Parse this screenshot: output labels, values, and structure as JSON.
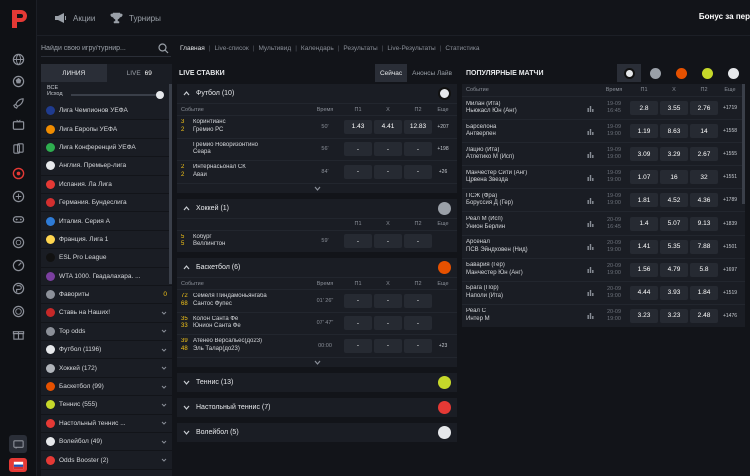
{
  "colors": {
    "brand": "#e53935",
    "accent_yellow": "#f5c518",
    "panel": "#1a1d24",
    "bg": "#121419"
  },
  "topbar": {
    "promos_label": "Акции",
    "tournaments_label": "Турниры",
    "bonus_label": "Бонус за пер"
  },
  "search": {
    "placeholder": "Найди свою игру/турнир..."
  },
  "breadcrumbs": [
    "Главная",
    "Live-список",
    "Мультивид",
    "Календарь",
    "Результаты",
    "Live-Результаты",
    "Статистика"
  ],
  "left": {
    "tab_line": "ЛИНИЯ",
    "tab_live": "LIVE",
    "tab_live_count": "69",
    "slider_label_1": "ВСЕ",
    "slider_label_2": "Исход",
    "items": [
      {
        "label": "Лига Чемпионов УЕФА",
        "icon": "ucl-icon",
        "color": "#1f3b8f",
        "badge": "",
        "chev": false
      },
      {
        "label": "Лига Европы УЕФА",
        "icon": "uel-icon",
        "color": "#f08c00",
        "badge": "",
        "chev": false
      },
      {
        "label": "Лига Конференций УЕФА",
        "icon": "uecl-icon",
        "color": "#2eae4f",
        "badge": "",
        "chev": false
      },
      {
        "label": "Англия. Премьер-лига",
        "icon": "epl-icon",
        "color": "#e6e8eb",
        "badge": "",
        "chev": false
      },
      {
        "label": "Испания. Ла Лига",
        "icon": "laliga-icon",
        "color": "#e53935",
        "badge": "",
        "chev": false
      },
      {
        "label": "Германия. Бундеслига",
        "icon": "bundesliga-icon",
        "color": "#d32f2f",
        "badge": "",
        "chev": false
      },
      {
        "label": "Италия. Серия А",
        "icon": "seriea-icon",
        "color": "#2e7bd6",
        "badge": "",
        "chev": false
      },
      {
        "label": "Франция. Лига 1",
        "icon": "ligue1-icon",
        "color": "#ffd54f",
        "badge": "",
        "chev": false
      },
      {
        "label": "ESL Pro League",
        "icon": "esl-icon",
        "color": "#111111",
        "badge": "",
        "chev": false
      },
      {
        "label": "WTA 1000. Гвадалахара. ...",
        "icon": "wta-icon",
        "color": "#7b3fa0",
        "badge": "",
        "chev": false
      },
      {
        "label": "Фавориты",
        "icon": "star-icon",
        "color": "#8c9099",
        "badge": "0",
        "chev": false
      },
      {
        "label": "Ставь на Наших!",
        "icon": "flag-icon",
        "color": "#c62828",
        "badge": "",
        "chev": true
      },
      {
        "label": "Top odds",
        "icon": "top-odds-icon",
        "color": "#8c9099",
        "badge": "",
        "chev": true
      },
      {
        "label": "Футбол (1196)",
        "icon": "football-icon",
        "color": "#e6e8eb",
        "badge": "",
        "chev": true
      },
      {
        "label": "Хоккей (172)",
        "icon": "hockey-icon",
        "color": "#b0b4ba",
        "badge": "",
        "chev": true
      },
      {
        "label": "Баскетбол (99)",
        "icon": "basketball-icon",
        "color": "#e65100",
        "badge": "",
        "chev": true
      },
      {
        "label": "Теннис (555)",
        "icon": "tennis-icon",
        "color": "#c6d82a",
        "badge": "",
        "chev": true
      },
      {
        "label": "Настольный теннис ...",
        "icon": "table-tennis-icon",
        "color": "#e53935",
        "badge": "",
        "chev": true
      },
      {
        "label": "Волейбол (49)",
        "icon": "volleyball-icon",
        "color": "#e6e8eb",
        "badge": "",
        "chev": true
      },
      {
        "label": "Odds Booster (2)",
        "icon": "odds-booster-icon",
        "color": "#e53935",
        "badge": "",
        "chev": true
      }
    ]
  },
  "live": {
    "title": "LIVE СТАВКИ",
    "tab_now": "Сейчас",
    "tab_announce": "Анонсы Лайв",
    "columns": {
      "event": "Событие",
      "time": "Время",
      "p1": "П1",
      "x": "X",
      "p2": "П2",
      "more": "Еще"
    },
    "football": {
      "title": "Футбол",
      "count": "(10)",
      "matches": [
        {
          "s1": "3",
          "t1": "Коринтианс",
          "s2": "2",
          "t2": "Гремио РС",
          "time": "50'",
          "p1": "1.43",
          "x": "4.41",
          "p2": "12.83",
          "more": "+207"
        },
        {
          "s1": "",
          "t1": "Гремио Новоризонтино",
          "s2": "",
          "t2": "Сеара",
          "time": "56'",
          "p1": "-",
          "x": "-",
          "p2": "-",
          "more": "+198"
        },
        {
          "s1": "2",
          "t1": "Интернасьонал СК",
          "s2": "2",
          "t2": "Аваи",
          "time": "84'",
          "p1": "-",
          "x": "-",
          "p2": "-",
          "more": "+26"
        }
      ]
    },
    "hockey": {
      "title": "Хоккей",
      "count": "(1)",
      "matches": [
        {
          "s1": "5",
          "t1": "Кобург",
          "s2": "5",
          "t2": "Веллингтон",
          "time": "59'",
          "p1": "-",
          "x": "-",
          "p2": "-",
          "more": ""
        }
      ]
    },
    "basketball": {
      "title": "Баскетбол",
      "count": "(6)",
      "matches": [
        {
          "s1": "72",
          "t1": "Семеля Пиндамоньянгаба",
          "s2": "68",
          "t2": "Сантос Фупес",
          "time": "01' 26\"",
          "p1": "-",
          "x": "-",
          "p2": "-",
          "more": ""
        },
        {
          "s1": "35",
          "t1": "Колон Санта Фе",
          "s2": "33",
          "t2": "Юнион Санта Фе",
          "time": "07' 47\"",
          "p1": "-",
          "x": "-",
          "p2": "-",
          "more": ""
        },
        {
          "s1": "39",
          "t1": "Атенео Версальес(до23)",
          "s2": "48",
          "t2": "Эль Талар(до23)",
          "time": "00:00",
          "p1": "-",
          "x": "-",
          "p2": "-",
          "more": "+23"
        }
      ]
    },
    "tennis": {
      "title": "Теннис",
      "count": "(13)"
    },
    "tabletennis": {
      "title": "Настольный теннис",
      "count": "(7)"
    },
    "volleyball": {
      "title": "Волейбол",
      "count": "(5)"
    }
  },
  "popular": {
    "title": "ПОПУЛЯРНЫЕ МАТЧИ",
    "columns": {
      "event": "Событие",
      "time": "Время",
      "p1": "П1",
      "x": "X",
      "p2": "П2",
      "more": "Еще"
    },
    "matches": [
      {
        "t1": "Милан (Ита)",
        "t2": "Ньюкасл Юн (Анг)",
        "date": "19-09",
        "time": "16:45",
        "p1": "2.8",
        "x": "3.55",
        "p2": "2.76",
        "more": "+1719"
      },
      {
        "t1": "Барселона",
        "t2": "Антверпен",
        "date": "19-09",
        "time": "19:00",
        "p1": "1.19",
        "x": "8.63",
        "p2": "14",
        "more": "+1558"
      },
      {
        "t1": "Лацио (Ита)",
        "t2": "Атлетико М (Исп)",
        "date": "19-09",
        "time": "19:00",
        "p1": "3.09",
        "x": "3.29",
        "p2": "2.67",
        "more": "+1555"
      },
      {
        "t1": "Манчестер Сити (Анг)",
        "t2": "Црвена Звезда",
        "date": "19-09",
        "time": "19:00",
        "p1": "1.07",
        "x": "16",
        "p2": "32",
        "more": "+1551"
      },
      {
        "t1": "ПСЖ (Фра)",
        "t2": "Боруссия Д (Гер)",
        "date": "19-09",
        "time": "19:00",
        "p1": "1.81",
        "x": "4.52",
        "p2": "4.36",
        "more": "+1789"
      },
      {
        "t1": "Реал М (Исп)",
        "t2": "Унион Берлин",
        "date": "20-09",
        "time": "16:45",
        "p1": "1.4",
        "x": "5.07",
        "p2": "9.13",
        "more": "+1839"
      },
      {
        "t1": "Арсенал",
        "t2": "ПСВ Эйндховен (Нид)",
        "date": "20-09",
        "time": "19:00",
        "p1": "1.41",
        "x": "5.35",
        "p2": "7.88",
        "more": "+1501"
      },
      {
        "t1": "Бавария (Гер)",
        "t2": "Манчестер Юн (Анг)",
        "date": "20-09",
        "time": "19:00",
        "p1": "1.56",
        "x": "4.79",
        "p2": "5.8",
        "more": "+1697"
      },
      {
        "t1": "Брага (Пор)",
        "t2": "Наполи (Ита)",
        "date": "20-09",
        "time": "19:00",
        "p1": "4.44",
        "x": "3.93",
        "p2": "1.84",
        "more": "+1519"
      },
      {
        "t1": "Реал С",
        "t2": "Интер М",
        "date": "20-09",
        "time": "19:00",
        "p1": "3.23",
        "x": "3.23",
        "p2": "2.48",
        "more": "+1476"
      }
    ]
  }
}
